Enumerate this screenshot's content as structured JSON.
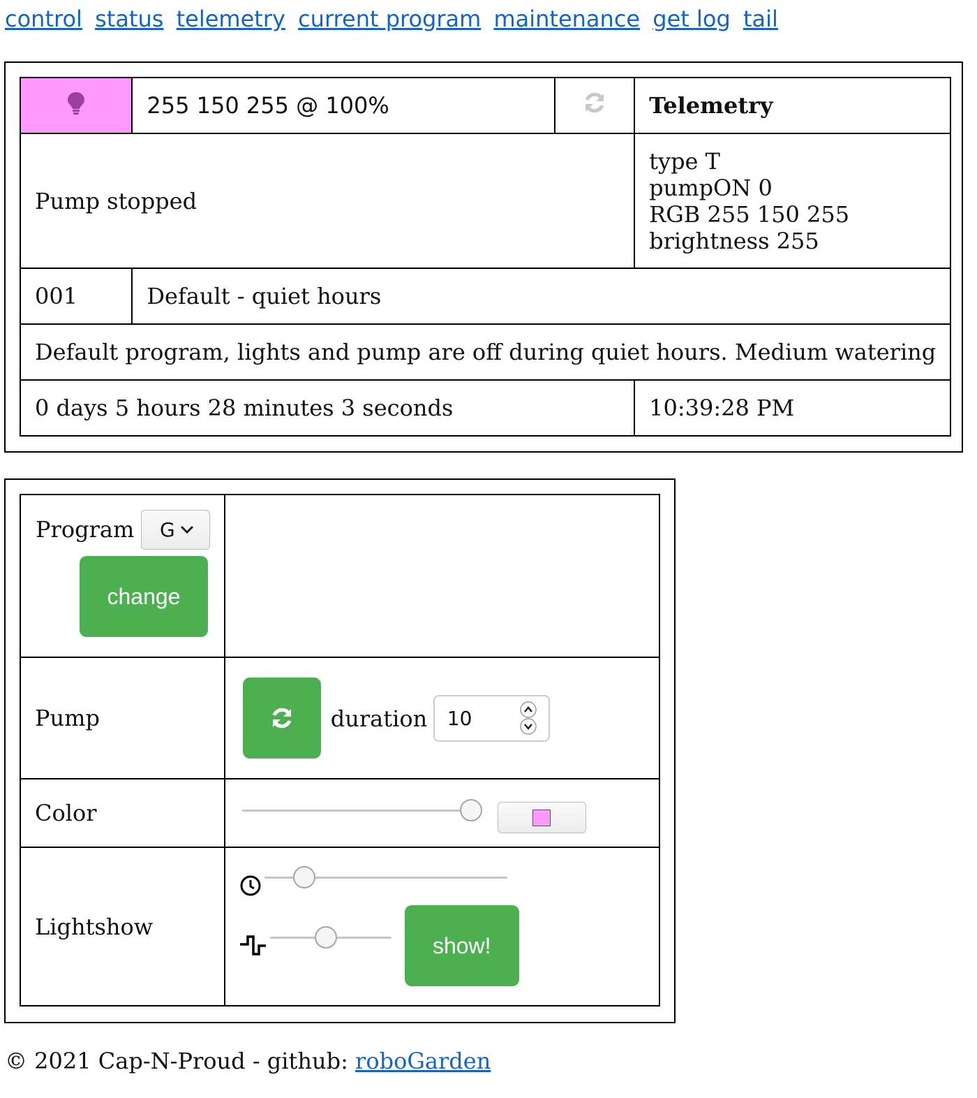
{
  "nav": {
    "links": [
      "control",
      "status",
      "telemetry",
      "current program",
      "maintenance",
      "get log",
      "tail"
    ]
  },
  "status": {
    "light_color": "#ff99ff",
    "light_icon": "lightbulb-icon",
    "rgb_text": "255 150 255 @ 100%",
    "refresh_icon": "refresh-icon",
    "telemetry_heading": "Telemetry",
    "pump_status": "Pump stopped",
    "telemetry_lines": [
      "type T",
      "pumpON 0",
      "RGB 255 150 255",
      "brightness 255"
    ],
    "program_number": "001",
    "program_name": "Default - quiet hours",
    "program_description": "Default program, lights and pump are off during quiet hours. Medium watering",
    "uptime": "0 days 5 hours 28 minutes 3 seconds",
    "clock": "10:39:28 PM"
  },
  "control": {
    "program_label": "Program",
    "program_select_value": "G",
    "change_button": "change",
    "pump_label": "Pump",
    "pump_button_icon": "refresh-icon",
    "duration_label": "duration",
    "duration_value": "10",
    "color_label": "Color",
    "color_slider_value": 1.0,
    "color_swatch": "#ff99ff",
    "lightshow_label": "Lightshow",
    "speed_icon": "clock-icon",
    "speed_slider_value": 0.13,
    "pattern_icon": "square-wave-icon",
    "pattern_slider_value": 0.45,
    "show_button": "show!",
    "button_color": "#4caf50"
  },
  "footer": {
    "text": "© 2021 Cap-N-Proud - github: ",
    "link": "roboGarden"
  }
}
